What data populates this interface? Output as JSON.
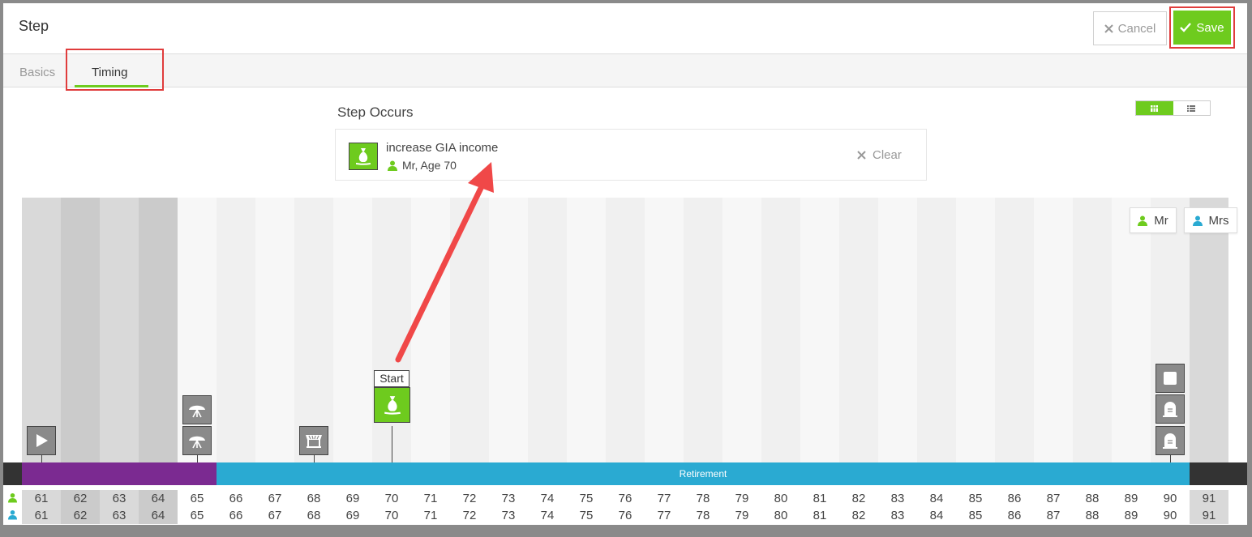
{
  "header": {
    "title": "Step",
    "cancel_label": "Cancel",
    "save_label": "Save"
  },
  "tabs": [
    {
      "label": "Basics",
      "active": false
    },
    {
      "label": "Timing",
      "active": true
    }
  ],
  "step_occurs": {
    "heading": "Step Occurs",
    "step_name": "increase GIA income",
    "step_person": "Mr, Age 70",
    "clear_label": "Clear",
    "view_options": [
      "calendar-view",
      "list-view"
    ]
  },
  "legend": [
    {
      "label": "Mr",
      "color": "#6ecb1e"
    },
    {
      "label": "Mrs",
      "color": "#2aaad2"
    }
  ],
  "timeline": {
    "bars": {
      "retirement_label": "Retirement"
    },
    "ages_mr": [
      "61",
      "62",
      "63",
      "64",
      "65",
      "66",
      "67",
      "68",
      "69",
      "70",
      "71",
      "72",
      "73",
      "74",
      "75",
      "76",
      "77",
      "78",
      "79",
      "80",
      "81",
      "82",
      "83",
      "84",
      "85",
      "86",
      "87",
      "88",
      "89",
      "90",
      "91"
    ],
    "ages_mrs": [
      "61",
      "62",
      "63",
      "64",
      "65",
      "66",
      "67",
      "68",
      "69",
      "70",
      "71",
      "72",
      "73",
      "74",
      "75",
      "76",
      "77",
      "78",
      "79",
      "80",
      "81",
      "82",
      "83",
      "84",
      "85",
      "86",
      "87",
      "88",
      "89",
      "90",
      "91"
    ],
    "start_label": "Start",
    "markers": [
      {
        "icon": "play-icon",
        "age": "61"
      },
      {
        "icon": "umbrella-icon",
        "age": "65"
      },
      {
        "icon": "umbrella-icon",
        "age": "65"
      },
      {
        "icon": "shop-icon",
        "age": "68"
      },
      {
        "icon": "money-bag-icon",
        "age": "70"
      },
      {
        "icon": "square-icon",
        "age": "90"
      },
      {
        "icon": "tombstone-icon",
        "age": "90"
      },
      {
        "icon": "tombstone-icon",
        "age": "90"
      }
    ]
  },
  "colors": {
    "accent_green": "#6ecb1e",
    "purple": "#7b2a91",
    "retirement_blue": "#2aaad2",
    "highlight_red": "#e03c3c"
  }
}
